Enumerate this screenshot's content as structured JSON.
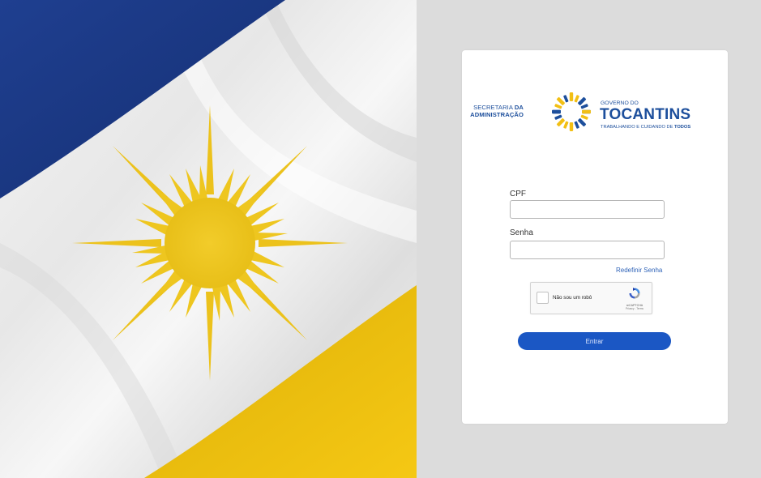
{
  "logo": {
    "secretaria_line1_prefix": "SECRETARIA ",
    "secretaria_line1_bold": "DA",
    "secretaria_line2": "ADMINISTRAÇÃO",
    "governo_small": "GOVERNO DO",
    "governo_big": "TOCANTINS",
    "tagline_prefix": "TRABALHANDO E CUIDANDO DE ",
    "tagline_bold": "TODOS"
  },
  "form": {
    "cpf_label": "CPF",
    "cpf_value": "",
    "senha_label": "Senha",
    "senha_value": "",
    "reset_link": "Redefinir Senha",
    "submit_label": "Entrar"
  },
  "recaptcha": {
    "label": "Não sou um robô",
    "brand": "reCAPTCHA",
    "terms": "Privacy - Terms"
  },
  "colors": {
    "flag_blue": "#1c3d8f",
    "flag_yellow": "#f2c511",
    "brand_blue": "#1d4f9c",
    "button_blue": "#1b57c4"
  }
}
